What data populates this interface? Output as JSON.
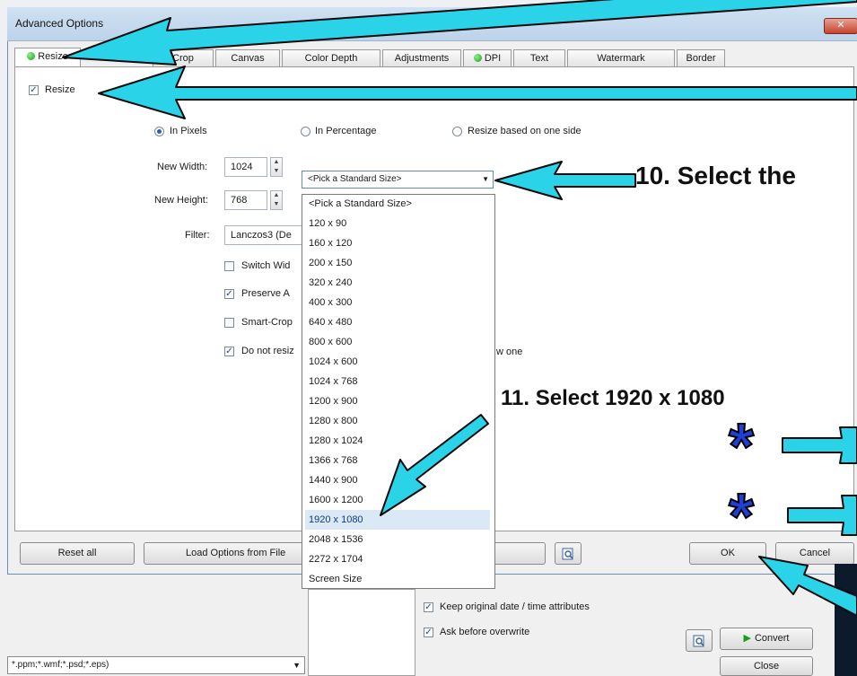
{
  "window": {
    "title": "Advanced Options",
    "close_glyph": "✕"
  },
  "tabs": [
    {
      "label": "Resize",
      "status_dot": true,
      "active": true
    },
    {
      "label": "Crop",
      "status_dot": false,
      "active": false
    },
    {
      "label": "Canvas",
      "status_dot": false,
      "active": false
    },
    {
      "label": "Color Depth",
      "status_dot": false,
      "active": false
    },
    {
      "label": "Adjustments",
      "status_dot": false,
      "active": false
    },
    {
      "label": "DPI",
      "status_dot": true,
      "active": false
    },
    {
      "label": "Text",
      "status_dot": false,
      "active": false
    },
    {
      "label": "Watermark",
      "status_dot": false,
      "active": false
    },
    {
      "label": "Border",
      "status_dot": false,
      "active": false
    }
  ],
  "resize": {
    "enable_label": "Resize",
    "enable_checked": true,
    "mode": {
      "in_pixels": "In Pixels",
      "in_percentage": "In Percentage",
      "based_on_side": "Resize based on one side",
      "selected": "in_pixels"
    },
    "new_width_label": "New Width:",
    "new_width_value": "1024",
    "new_height_label": "New Height:",
    "new_height_value": "768",
    "filter_label": "Filter:",
    "filter_value": "Lanczos3 (De",
    "options": [
      {
        "label": "Switch Wid",
        "checked": false
      },
      {
        "label": "Preserve A",
        "checked": true
      },
      {
        "label": "Smart-Crop",
        "checked": false
      },
      {
        "label": "Do not resiz",
        "checked": true
      }
    ],
    "do_not_resize_tail": "w one"
  },
  "standard_size": {
    "selected": "<Pick a Standard Size>",
    "items": [
      "<Pick a Standard Size>",
      "120 x 90",
      "160 x 120",
      "200 x 150",
      "320 x 240",
      "400 x 300",
      "640 x 480",
      "800 x 600",
      "1024 x 600",
      "1024 x 768",
      "1200 x 900",
      "1280 x 800",
      "1280 x 1024",
      "1366 x 768",
      "1440 x 900",
      "1600 x 1200",
      "1920 x 1080",
      "2048 x 1536",
      "2272 x 1704",
      "Screen Size"
    ],
    "highlighted": "1920 x 1080"
  },
  "footer": {
    "reset_all": "Reset all",
    "load_options": "Load Options from File",
    "ok": "OK",
    "cancel": "Cancel"
  },
  "lower_window": {
    "file_filter": "*.ppm;*.wmf;*.psd;*.eps)",
    "keep_dates": "Keep original date / time attributes",
    "ask_overwrite": "Ask before overwrite",
    "convert": "Convert",
    "close": "Close"
  },
  "annotations": {
    "step10": "10. Select the",
    "step11": "11. Select 1920 x 1080",
    "marker": "*"
  },
  "colors": {
    "arrow": "#2ad3e8",
    "arrow_outline": "#0a0a0a",
    "marker": "#1f3fd6",
    "selected_bg": "#dbe9f7"
  }
}
